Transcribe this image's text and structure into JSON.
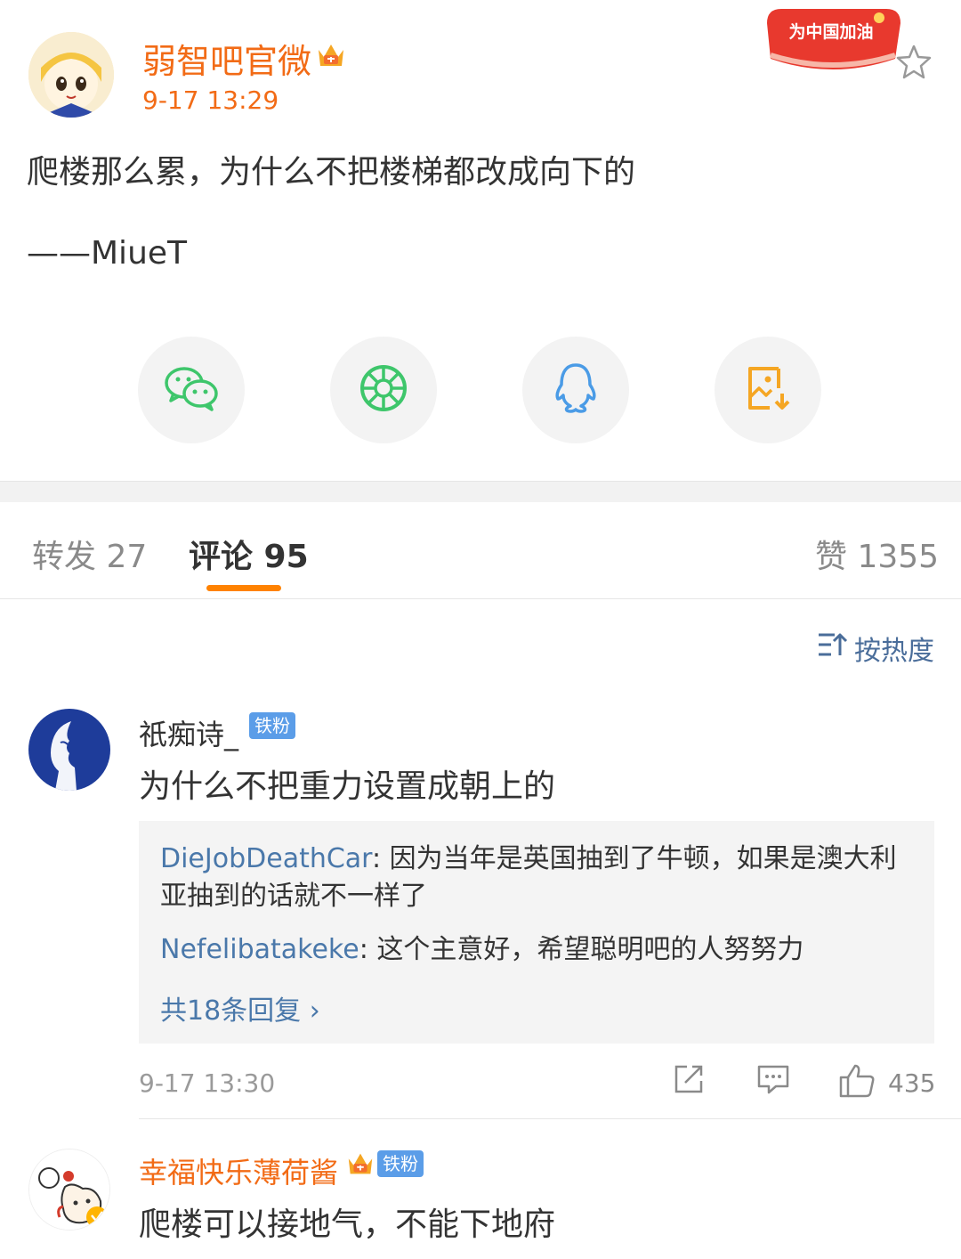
{
  "post": {
    "author": "弱智吧官微",
    "time": "9-17 13:29",
    "banner_text": "为中国加油",
    "text": "爬楼那么累，为什么不把楼梯都改成向下的",
    "signature": "——MiueT"
  },
  "share": {
    "icons": [
      "wechat-icon",
      "moments-icon",
      "qq-icon",
      "save-image-icon"
    ],
    "colors": {
      "wechat": "#3ec66b",
      "moments": "#3ec66b",
      "qq": "#4a9be6",
      "save": "#f5a623"
    }
  },
  "tabs": {
    "repost": "转发 27",
    "comments": "评论 95",
    "likes": "赞 1355"
  },
  "sort": {
    "label": "按热度"
  },
  "comments": [
    {
      "user": "祇痴诗_",
      "badge": "铁粉",
      "text": "为什么不把重力设置成朝上的",
      "replies": [
        {
          "user": "DieJobDeathCar",
          "text": ": 因为当年是英国抽到了牛顿，如果是澳大利亚抽到的话就不一样了"
        },
        {
          "user": "Nefelibatakeke",
          "text": ": 这个主意好，希望聪明吧的人努努力"
        }
      ],
      "more_replies": "共18条回复 ›",
      "time": "9-17 13:30",
      "likes": "435"
    },
    {
      "user": "幸福快乐薄荷酱",
      "badge": "铁粉",
      "text": "爬楼可以接地气，不能下地府"
    }
  ],
  "colors": {
    "accent": "#ff8200",
    "author": "#f26b16",
    "link": "#4a78aa",
    "badge": "#5b9de8"
  }
}
